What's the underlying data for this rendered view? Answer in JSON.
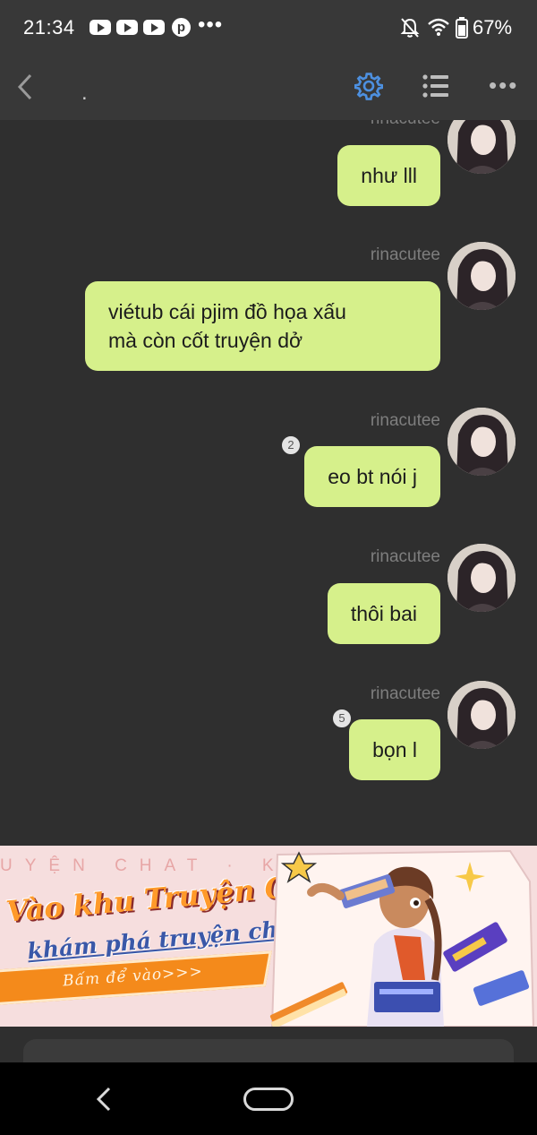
{
  "status_bar": {
    "time": "21:34",
    "notification_icons": [
      "youtube-icon",
      "youtube-icon",
      "youtube-icon",
      "pinterest-icon"
    ],
    "more_indicator": "•••",
    "battery_percent": "67%"
  },
  "nav": {
    "title": ".",
    "accent_color": "#4d90e0"
  },
  "messages": [
    {
      "sender": "rinacutee",
      "lines": [
        "như lll"
      ],
      "badge": ""
    },
    {
      "sender": "rinacutee",
      "lines": [
        "viétub cái pjim đồ họa xấu",
        "mà còn cốt truyện dở"
      ],
      "badge": ""
    },
    {
      "sender": "rinacutee",
      "lines": [
        "eo bt nói j"
      ],
      "badge": "2"
    },
    {
      "sender": "rinacutee",
      "lines": [
        "thôi bai"
      ],
      "badge": ""
    },
    {
      "sender": "rinacutee",
      "lines": [
        "bọn l"
      ],
      "badge": "5"
    }
  ],
  "banner": {
    "bg_text": "UYỆN CHAT · KHÁM PHÁ",
    "title": "Vào khu Truyện Chat,",
    "subtitle": "khám phá truyện chất",
    "cta": "Bấm để vào>>>"
  },
  "colors": {
    "bubble": "#d6f08b",
    "background": "#2f2f2f",
    "header": "#383838"
  }
}
